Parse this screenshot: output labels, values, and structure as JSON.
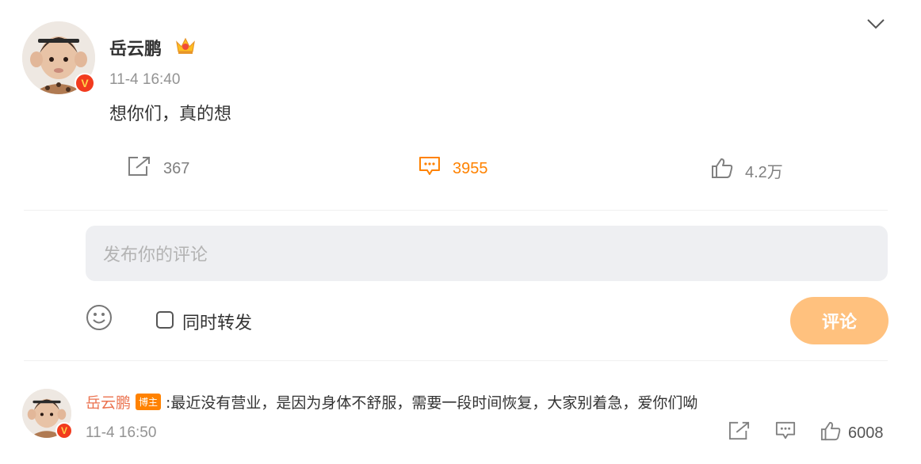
{
  "post": {
    "author_name": "岳云鹏",
    "time": "11-4 16:40",
    "text": "想你们，真的想",
    "actions": {
      "repost_count": "367",
      "comment_count": "3955",
      "like_count": "4.2万"
    }
  },
  "composer": {
    "placeholder": "发布你的评论",
    "repost_label": "同时转发",
    "submit_label": "评论"
  },
  "comments": [
    {
      "author_name": "岳云鹏",
      "badge": "博主",
      "text": ":最近没有营业，是因为身体不舒服，需要一段时间恢复，大家别着急，爱你们呦",
      "time": "11-4 16:50",
      "like_count": "6008"
    }
  ],
  "colors": {
    "accent": "#ff8200",
    "name_link": "#eb7350",
    "verified": "#f23b1e",
    "submit_bg": "#ffc17e"
  }
}
